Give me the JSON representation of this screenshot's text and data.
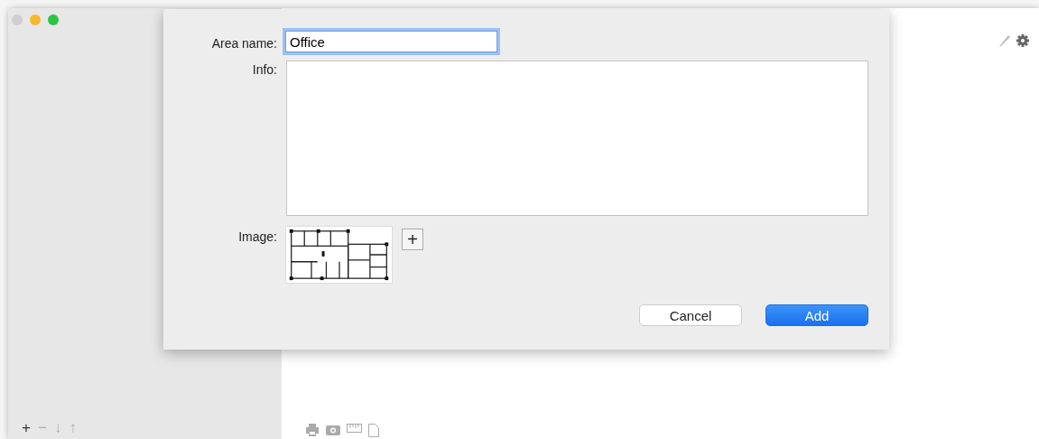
{
  "window": {
    "controls": [
      {
        "kind": "close",
        "disabled": true
      },
      {
        "kind": "minimize",
        "disabled": false
      },
      {
        "kind": "zoom",
        "disabled": false
      }
    ]
  },
  "sidebar": {
    "toolbar": [
      {
        "label": "+",
        "disabled": false
      },
      {
        "label": "−",
        "disabled": true
      },
      {
        "label": "↓",
        "disabled": true
      },
      {
        "label": "↑",
        "disabled": true
      }
    ]
  },
  "dialog": {
    "area_name": {
      "label": "Area name:",
      "value": "Office",
      "focused": true
    },
    "info": {
      "label": "Info:"
    },
    "image": {
      "label": "Image:",
      "add_label": "+"
    },
    "buttons": [
      {
        "label": "Cancel",
        "kind": "secondary"
      },
      {
        "label": "Add",
        "kind": "primary"
      }
    ]
  }
}
